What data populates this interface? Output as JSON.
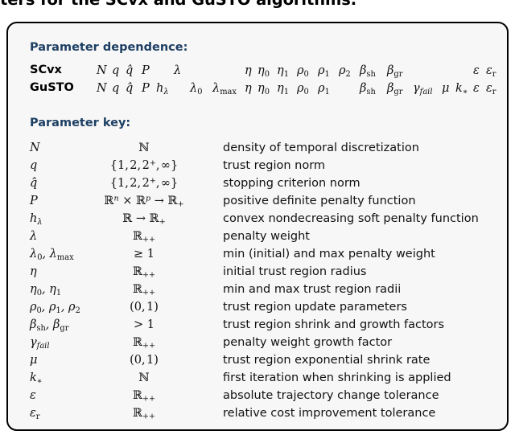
{
  "caption": {
    "text": "ters for the SCvx and GuSTO algorithms."
  },
  "colors": {
    "heading": "#1d3f63",
    "box_background": "#f7f7f7",
    "box_border": "#000000",
    "text": "#111111"
  },
  "dependence": {
    "heading": "Parameter dependence:",
    "rows": [
      {
        "algorithm": "SCvx",
        "symbols": [
          "N",
          "q",
          "q̂",
          "P",
          "λ",
          "η",
          "η₀",
          "η₁",
          "ρ₀",
          "ρ₁",
          "ρ₂",
          "βsh",
          "βgr",
          "ε",
          "εr"
        ]
      },
      {
        "algorithm": "GuSTO",
        "symbols": [
          "N",
          "q",
          "q̂",
          "P",
          "hλ",
          "λ₀",
          "λmax",
          "η",
          "η₀",
          "η₁",
          "ρ₀",
          "ρ₁",
          "βsh",
          "βgr",
          "γfail",
          "μ",
          "k∗",
          "ε",
          "εr"
        ]
      }
    ]
  },
  "key": {
    "heading": "Parameter key:",
    "rows": [
      {
        "symbol": "N",
        "domain": "ℕ",
        "description": "density of temporal discretization"
      },
      {
        "symbol": "q",
        "domain": "{1, 2, 2⁺, ∞}",
        "description": "trust region norm"
      },
      {
        "symbol": "q̂",
        "domain": "{1, 2, 2⁺, ∞}",
        "description": "stopping criterion norm"
      },
      {
        "symbol": "P",
        "domain": "ℝⁿ × ℝᵖ → ℝ₊",
        "description": "positive definite penalty function"
      },
      {
        "symbol": "hλ",
        "domain": "ℝ → ℝ₊",
        "description": "convex nondecreasing soft penalty function"
      },
      {
        "symbol": "λ",
        "domain": "ℝ₊₊",
        "description": "penalty weight"
      },
      {
        "symbol": "λ₀, λmax",
        "domain": "≥ 1",
        "description": "min (initial) and max penalty weight"
      },
      {
        "symbol": "η",
        "domain": "ℝ₊₊",
        "description": "initial trust region radius"
      },
      {
        "symbol": "η₀, η₁",
        "domain": "ℝ₊₊",
        "description": "min and max trust region radii"
      },
      {
        "symbol": "ρ₀, ρ₁, ρ₂",
        "domain": "(0, 1)",
        "description": "trust region update parameters"
      },
      {
        "symbol": "βsh, βgr",
        "domain": "> 1",
        "description": "trust region shrink and growth factors"
      },
      {
        "symbol": "γfail",
        "domain": "ℝ₊₊",
        "description": "penalty weight growth factor"
      },
      {
        "symbol": "μ",
        "domain": "(0, 1)",
        "description": "trust region exponential shrink rate"
      },
      {
        "symbol": "k∗",
        "domain": "ℕ",
        "description": "first iteration when shrinking is applied"
      },
      {
        "symbol": "ε",
        "domain": "ℝ₊₊",
        "description": "absolute trajectory change tolerance"
      },
      {
        "symbol": "εr",
        "domain": "ℝ₊₊",
        "description": "relative cost improvement tolerance"
      }
    ]
  }
}
